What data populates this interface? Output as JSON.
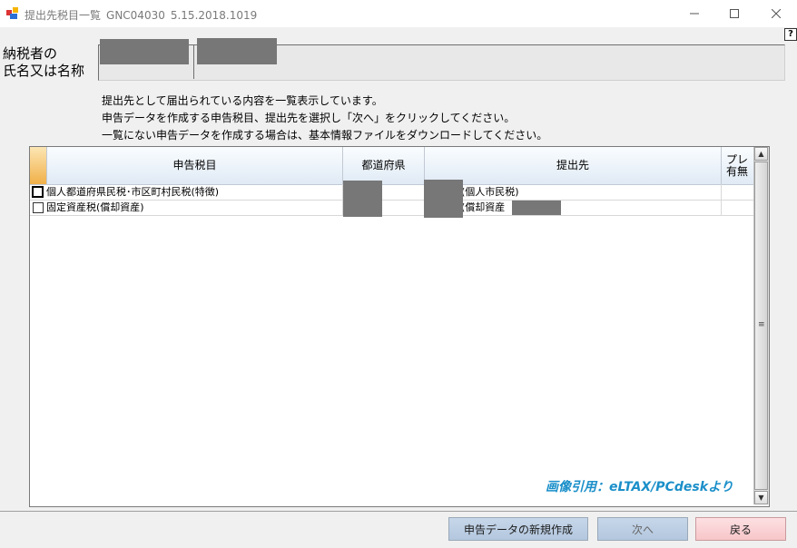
{
  "window": {
    "title": "提出先税目一覧",
    "code": "GNC04030",
    "version": "5.15.2018.1019"
  },
  "help_label": "?",
  "taxpayer": {
    "label_line1": "納税者の",
    "label_line2": "氏名又は名称"
  },
  "instructions": [
    "提出先として届出られている内容を一覧表示しています。",
    "申告データを作成する申告税目、提出先を選択し「次へ」をクリックしてください。",
    "一覧にない申告データを作成する場合は、基本情報ファイルをダウンロードしてください。"
  ],
  "grid": {
    "headers": {
      "tax_item": "申告税目",
      "prefecture": "都道府県",
      "destination": "提出先",
      "preprint_line1": "プレ",
      "preprint_line2": "有無"
    },
    "rows": [
      {
        "checked": false,
        "tax_item": "個人都道府県民税･市区町村民税(特徴)",
        "prefecture": "",
        "destination": "(個人市民税)"
      },
      {
        "checked": false,
        "tax_item": "固定資産税(償却資産)",
        "prefecture": "",
        "destination": "(償却資産"
      }
    ]
  },
  "watermark": "画像引用：eLTAX/PCdeskより",
  "buttons": {
    "new": "申告データの新規作成",
    "next": "次へ",
    "back": "戻る"
  }
}
